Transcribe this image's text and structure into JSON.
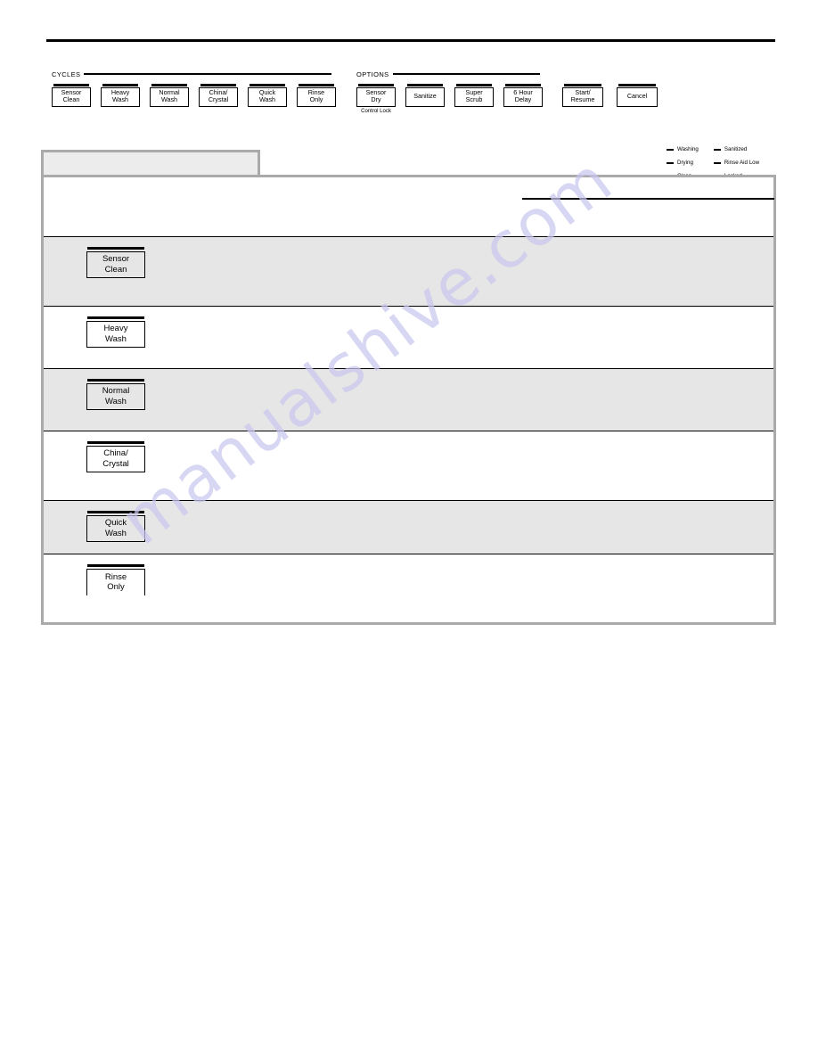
{
  "control_panel": {
    "cycles_group": {
      "label": "CYCLES",
      "buttons": [
        {
          "name": "sensor-clean",
          "lines": [
            "Sensor",
            "Clean"
          ]
        },
        {
          "name": "heavy-wash",
          "lines": [
            "Heavy",
            "Wash"
          ]
        },
        {
          "name": "normal-wash",
          "lines": [
            "Normal",
            "Wash"
          ]
        },
        {
          "name": "china-crystal",
          "lines": [
            "China/",
            "Crystal"
          ]
        },
        {
          "name": "quick-wash",
          "lines": [
            "Quick",
            "Wash"
          ]
        },
        {
          "name": "rinse-only",
          "lines": [
            "Rinse",
            "Only"
          ]
        }
      ]
    },
    "options_group": {
      "label": "OPTIONS",
      "buttons": [
        {
          "name": "sensor-dry",
          "lines": [
            "Sensor",
            "Dry"
          ],
          "sublabel": "Control Lock"
        },
        {
          "name": "sanitize",
          "lines": [
            "Sanitize"
          ]
        },
        {
          "name": "super-scrub",
          "lines": [
            "Super",
            "Scrub"
          ]
        },
        {
          "name": "six-hour-delay",
          "lines": [
            "6 Hour",
            "Delay"
          ]
        }
      ]
    },
    "action_buttons": [
      {
        "name": "start-resume",
        "lines": [
          "Start/",
          "Resume"
        ]
      },
      {
        "name": "cancel",
        "lines": [
          "Cancel"
        ]
      }
    ],
    "indicators": {
      "column_left": [
        "Washing",
        "Drying",
        "Clean"
      ],
      "column_right": [
        "Sanitized",
        "Rinse Aid Low",
        "Locked"
      ]
    }
  },
  "cycle_table": {
    "tab_label": "",
    "header": {
      "title": "",
      "note": ""
    },
    "rows": [
      {
        "cycle": {
          "name": "sensor-clean",
          "lines": [
            "Sensor",
            "Clean"
          ]
        },
        "description": "",
        "shaded": true
      },
      {
        "cycle": {
          "name": "heavy-wash",
          "lines": [
            "Heavy",
            "Wash"
          ]
        },
        "description": "",
        "shaded": false
      },
      {
        "cycle": {
          "name": "normal-wash",
          "lines": [
            "Normal",
            "Wash"
          ]
        },
        "description": "",
        "shaded": true
      },
      {
        "cycle": {
          "name": "china-crystal",
          "lines": [
            "China/",
            "Crystal"
          ]
        },
        "description": "",
        "shaded": false
      },
      {
        "cycle": {
          "name": "quick-wash",
          "lines": [
            "Quick",
            "Wash"
          ]
        },
        "description": "",
        "shaded": true
      },
      {
        "cycle": {
          "name": "rinse-only",
          "lines": [
            "Rinse",
            "Only"
          ]
        },
        "description": "",
        "shaded": false
      }
    ]
  },
  "watermark": {
    "text": "manualshive.com",
    "color": "#c9c7ef"
  },
  "colors": {
    "rule": "#000000",
    "table_border": "#aaaaaa",
    "row_shaded": "#e6e6e6",
    "tab_fill": "#ececec"
  }
}
